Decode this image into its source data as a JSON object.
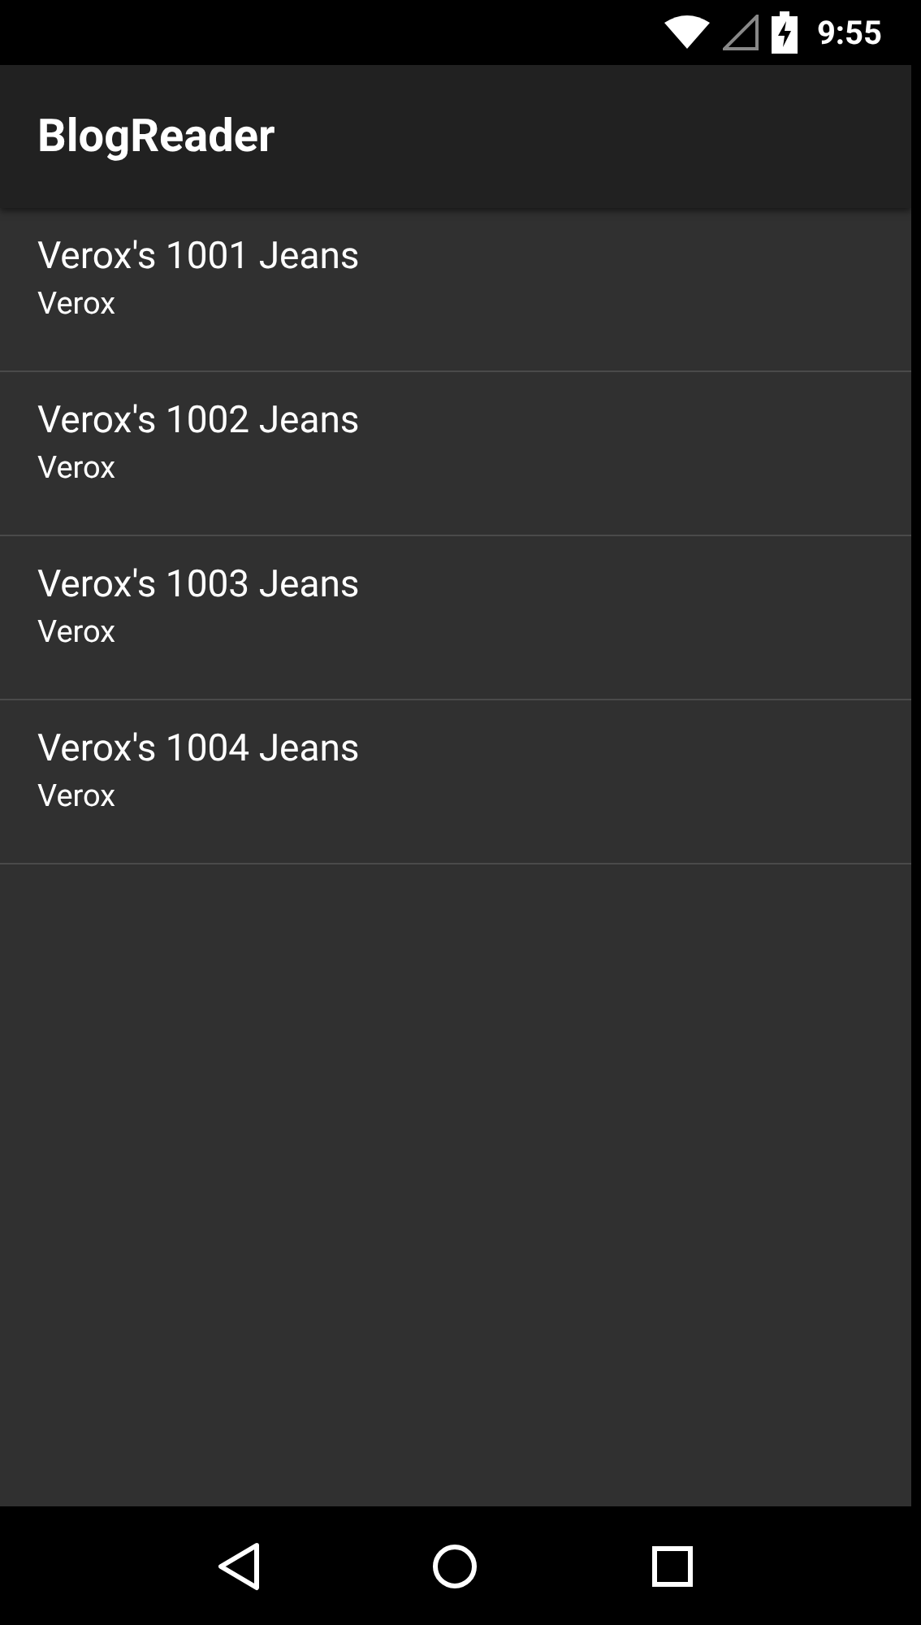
{
  "status_bar": {
    "time": "9:55"
  },
  "app_bar": {
    "title": "BlogReader"
  },
  "posts": [
    {
      "title": "Verox's 1001 Jeans",
      "author": "Verox"
    },
    {
      "title": "Verox's 1002 Jeans",
      "author": "Verox"
    },
    {
      "title": "Verox's 1003 Jeans",
      "author": "Verox"
    },
    {
      "title": "Verox's 1004 Jeans",
      "author": "Verox"
    }
  ]
}
